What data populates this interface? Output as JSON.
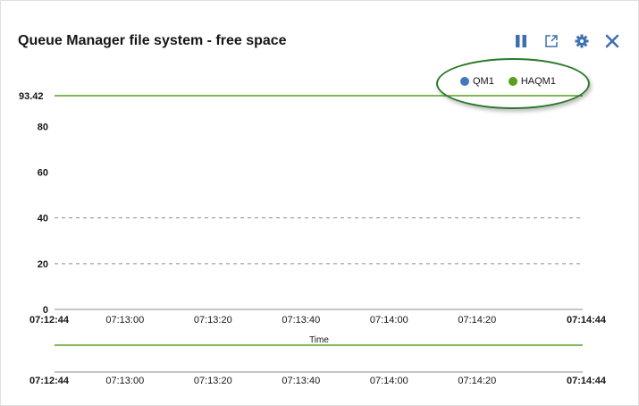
{
  "widget": {
    "title": "Queue Manager file system - free space"
  },
  "toolbar": {
    "pause": "pause-icon",
    "popout": "popout-icon",
    "settings": "gear-icon",
    "close": "close-icon",
    "icon_color": "#3d70b2"
  },
  "chart_data": {
    "type": "line",
    "title": "",
    "xlabel": "Time",
    "ylabel": "",
    "x_start": "07:12:44",
    "x_end": "07:14:44",
    "x_ticks": [
      "07:12:44",
      "07:13:00",
      "07:13:20",
      "07:13:40",
      "07:14:00",
      "07:14:20",
      "07:14:44"
    ],
    "y_ticks": [
      "0",
      "20",
      "40",
      "60",
      "80",
      "93.42"
    ],
    "ylim": [
      0,
      93.42
    ],
    "grid": true,
    "legend_placement": "top-right",
    "series": [
      {
        "name": "QM1",
        "color": "#4178be",
        "x": [],
        "y": []
      },
      {
        "name": "HAQM1",
        "color": "#5a9e1e",
        "x": [
          "07:12:44",
          "07:14:44"
        ],
        "y": [
          93.42,
          93.42
        ]
      }
    ],
    "brush": {
      "x_ticks": [
        "07:12:44",
        "07:13:00",
        "07:13:20",
        "07:13:40",
        "07:14:00",
        "07:14:20",
        "07:14:44"
      ]
    }
  }
}
